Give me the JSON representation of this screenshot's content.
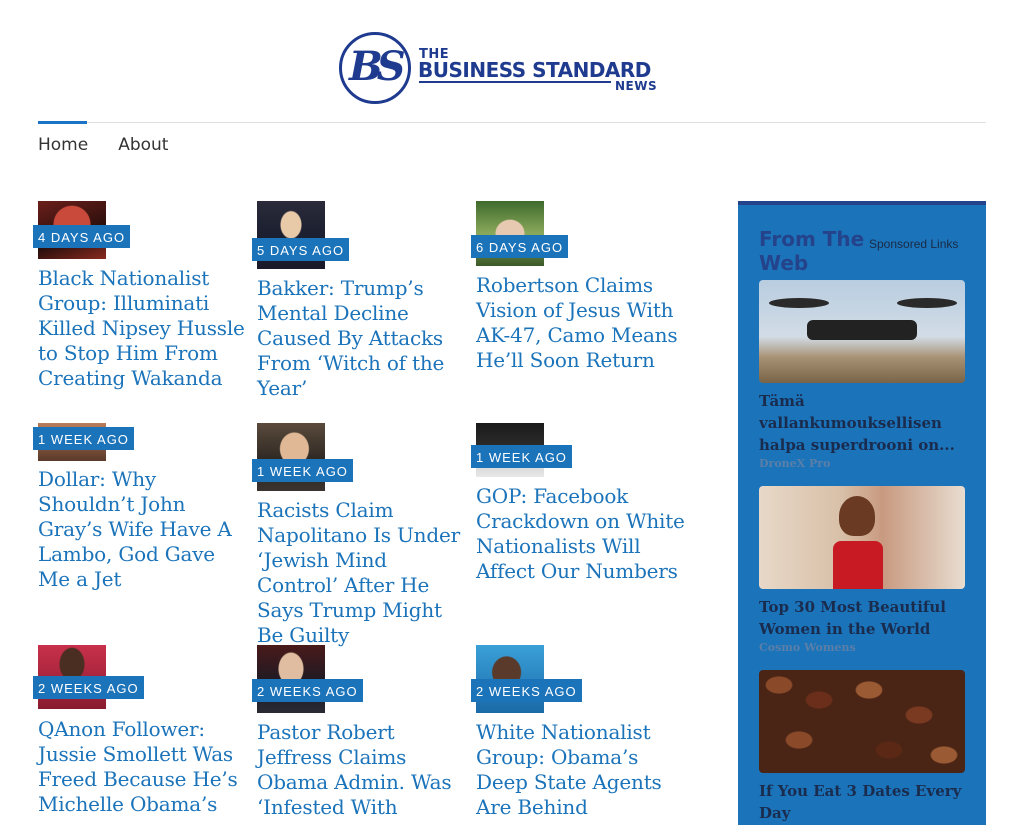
{
  "logo": {
    "emblem": "BS",
    "the": "THE",
    "main": "BUSINESS STANDARD",
    "news": "NEWS"
  },
  "nav": {
    "items": [
      {
        "label": "Home",
        "active": true
      },
      {
        "label": "About",
        "active": false
      }
    ]
  },
  "articles": [
    {
      "age": "4 DAYS AGO",
      "title": "Black Nationalist Group: Illuminati Killed Nipsey Hussle to Stop Him From Creating Wakanda"
    },
    {
      "age": "5 DAYS AGO",
      "title": "Bakker: Trump’s Mental Decline Caused By Attacks From ‘Witch of the Year’"
    },
    {
      "age": "6 DAYS AGO",
      "title": "Robertson Claims Vision of Jesus With AK-47, Camo Means He’ll Soon Return"
    },
    {
      "age": "1 WEEK AGO",
      "title": "Dollar: Why Shouldn’t John Gray’s Wife Have A Lambo, God Gave Me a Jet"
    },
    {
      "age": "1 WEEK AGO",
      "title": "Racists Claim Napolitano Is Under ‘Jewish Mind Control’ After He Says Trump Might Be Guilty"
    },
    {
      "age": "1 WEEK AGO",
      "title": "GOP: Facebook Crackdown on White Nationalists Will Affect Our Numbers"
    },
    {
      "age": "2 WEEKS AGO",
      "title": "QAnon Follower: Jussie Smollett Was Freed Because He’s Michelle Obama’s"
    },
    {
      "age": "2 WEEKS AGO",
      "title": "Pastor Robert Jeffress Claims Obama Admin. Was ‘Infested With"
    },
    {
      "age": "2 WEEKS AGO",
      "title": "White Nationalist Group: Obama’s Deep State Agents Are Behind"
    }
  ],
  "sidebar": {
    "heading": "From The Web",
    "sponsored": "Sponsored Links",
    "promos": [
      {
        "title": "Tämä vallankumouksellisen halpa superdrooni on...",
        "source": "DroneX Pro"
      },
      {
        "title": "Top 30 Most Beautiful Women in the World",
        "source": "Cosmo Womens"
      },
      {
        "title": "If You Eat 3 Dates Every Day",
        "source": ""
      }
    ]
  },
  "colors": {
    "accent": "#1b73ba",
    "brand": "#1f3b8f",
    "sidebar_border": "#25438b"
  }
}
